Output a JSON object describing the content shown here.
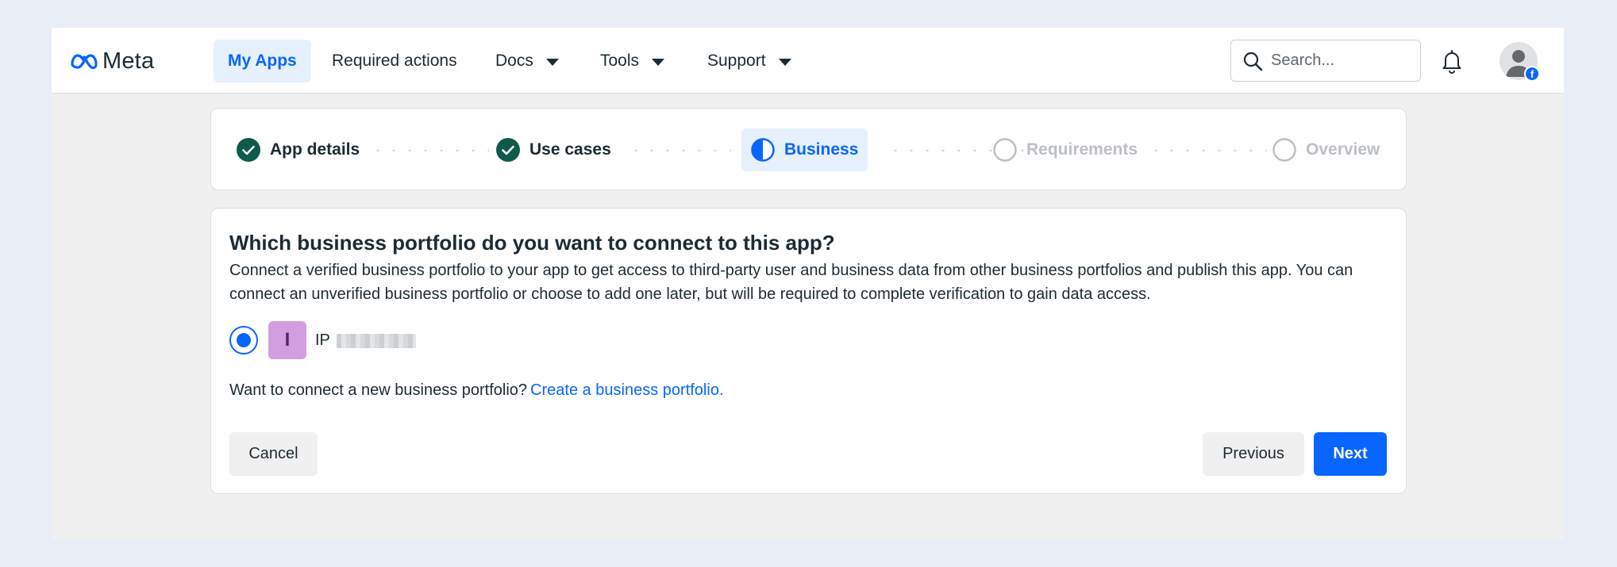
{
  "brand": {
    "name": "Meta",
    "color": "#0866ff"
  },
  "nav": {
    "items": [
      {
        "label": "My Apps",
        "active": true
      },
      {
        "label": "Required actions"
      },
      {
        "label": "Docs",
        "has_dropdown": true
      },
      {
        "label": "Tools",
        "has_dropdown": true
      },
      {
        "label": "Support",
        "has_dropdown": true
      }
    ],
    "search_placeholder": "Search...",
    "icons": [
      "search-icon",
      "bell-icon",
      "user-avatar-icon",
      "facebook-badge-icon"
    ]
  },
  "stepper": {
    "steps": [
      {
        "label": "App details",
        "status": "completed"
      },
      {
        "label": "Use cases",
        "status": "completed"
      },
      {
        "label": "Business",
        "status": "in-progress"
      },
      {
        "label": "Requirements",
        "status": "pending"
      },
      {
        "label": "Overview",
        "status": "pending"
      }
    ]
  },
  "card": {
    "title": "Which business portfolio do you want to connect to this app?",
    "description": "Connect a verified business portfolio to your app to get access to third-party user and business data from other business portfolios and publish this app. You can connect an unverified business portfolio or choose to add one later, but will be required to complete verification to gain data access.",
    "portfolio": {
      "initial": "I",
      "name_prefix": "IP",
      "selected": true,
      "avatar_color": "#d39ee0"
    },
    "connect_prompt": "Want to connect a new business portfolio?",
    "connect_link": "Create a business portfolio.",
    "buttons": {
      "cancel": "Cancel",
      "previous": "Previous",
      "next": "Next"
    }
  },
  "colors": {
    "completed": "#0f5a4a",
    "active_bg": "#e7f0fd",
    "pending": "#bcc0c4",
    "page_bg": "#e9eef6"
  }
}
